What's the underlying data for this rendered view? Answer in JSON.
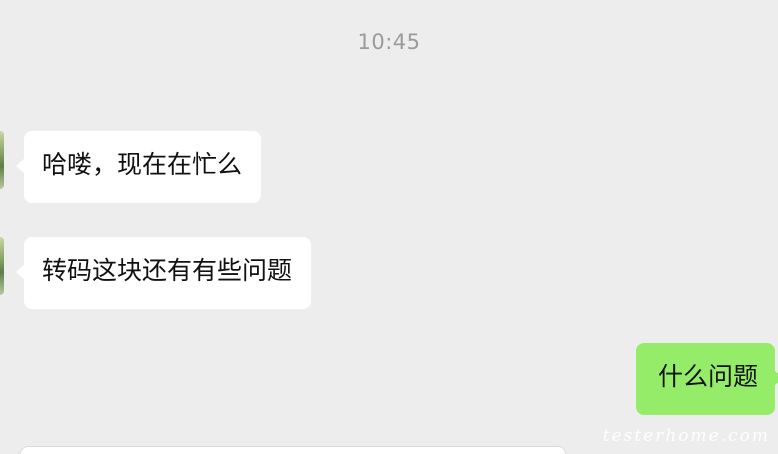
{
  "timestamp": "10:45",
  "messages": [
    {
      "direction": "incoming",
      "text": "哈喽，现在在忙么"
    },
    {
      "direction": "incoming",
      "text": "转码这块还有有些问题"
    },
    {
      "direction": "outgoing",
      "text": "什么问题"
    }
  ],
  "watermark": "testerhome.com",
  "colors": {
    "background": "#EDEDED",
    "incoming_bubble": "#FFFFFF",
    "outgoing_bubble": "#95EC69",
    "timestamp_text": "#9B9B9B"
  }
}
